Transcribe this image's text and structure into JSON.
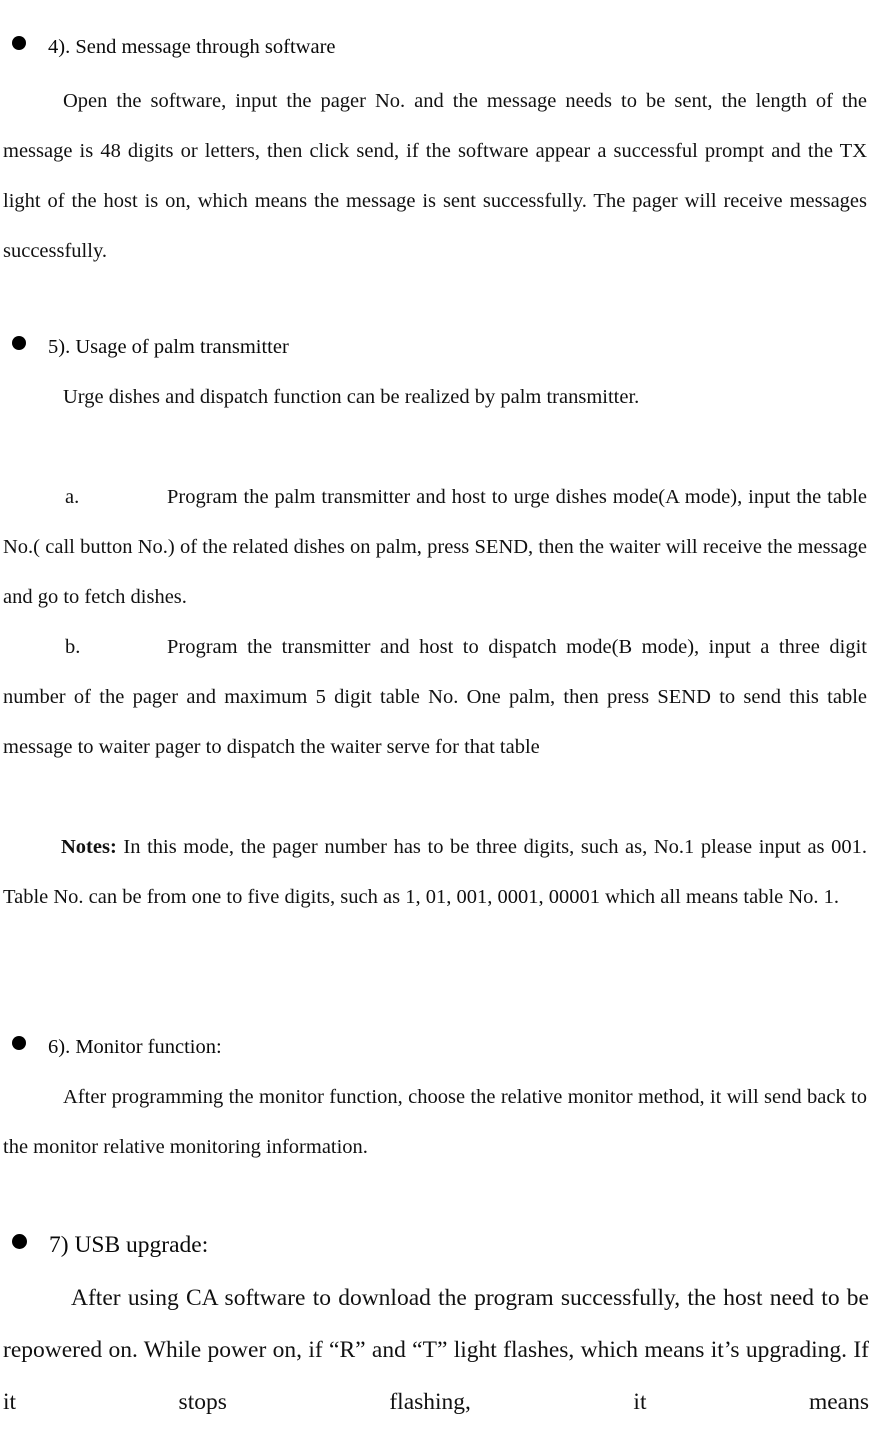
{
  "document": {
    "type": "product-manual-page",
    "language": "en",
    "background_color": "#ffffff",
    "text_color": "#111111"
  },
  "sections": [
    {
      "id": "send-message-software",
      "bullet": "●",
      "heading": "4). Send message through software",
      "body": "Open the software, input the pager No. and the message needs to be sent, the length of the message is 48 digits or letters, then click send, if the software appear a successful prompt and the TX light of the host is on, which means the message is sent successfully. The pager will receive messages successfully."
    },
    {
      "id": "palm-transmitter",
      "bullet": "●",
      "heading": "5). Usage of palm transmitter",
      "body": "Urge dishes and dispatch function can be realized by palm transmitter.",
      "sub_items": [
        {
          "label": "a.",
          "text": "Program the palm transmitter and host to urge dishes mode(A mode), input the table No.( call button No.) of the related dishes on palm, press SEND, then the waiter will receive the message and go to fetch dishes."
        },
        {
          "label": "b.",
          "text": "Program the transmitter and host to dispatch mode(B mode), input a three digit number of the pager and maximum 5 digit table No. One palm, then press SEND to send this table message to waiter pager to dispatch the waiter serve for that table"
        }
      ],
      "note": {
        "lead": "Notes:",
        "text": "In this mode, the pager number has to be three digits, such as, No.1 please input as 001. Table No. can be from one to five digits, such as 1, 01, 001, 0001, 00001 which all means table No. 1."
      }
    },
    {
      "id": "monitor-function",
      "bullet": "●",
      "heading": "6). Monitor function:",
      "body": "After programming the monitor function, choose the relative monitor method, it will send back to the monitor relative monitoring information."
    },
    {
      "id": "usb-upgrade",
      "bullet": "●",
      "heading": "7) USB upgrade:",
      "body": "After using CA software to download the program successfully, the host need to be repowered on. While power on, if “R” and “T” light flashes, which means it’s upgrading. If it stops flashing, it means"
    }
  ]
}
